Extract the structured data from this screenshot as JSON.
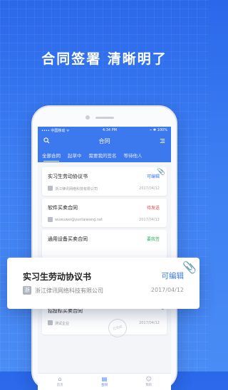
{
  "headline": "合同签署  清晰明了",
  "phone": {
    "status_bar": {
      "carrier": "•••• 中国移动 ᯤ",
      "time": "4:34 PM",
      "battery": "⌁ ✱ 100%"
    },
    "navbar": {
      "title": "合同"
    },
    "tabs": [
      "全部合同",
      "起草中",
      "需要我的签名",
      "等待他人"
    ],
    "cards": [
      {
        "title": "实习生劳动协议书",
        "status": "可编辑",
        "status_color": "#3c78ee",
        "company": "浙江律讯网络科技有限公司",
        "date": "2017/04/12",
        "clip": true
      },
      {
        "title": "软件买卖合同",
        "status": "待发送",
        "status_color": "#e8464d",
        "company": "wuwuwei@yuntaiwang.net",
        "date": "2017/04/12",
        "clip": false
      },
      {
        "title": "通用设备买卖合同",
        "status": "要我签",
        "status_color": "#2cab5a",
        "company": "",
        "date": "",
        "clip": false
      },
      {
        "title": "招投标买卖合同",
        "status": "",
        "status_color": "#999999",
        "company": "测试企业",
        "date": "2017/04/12",
        "clip": true,
        "stamp": "已完成"
      }
    ],
    "tabbar": [
      {
        "label": "首页",
        "icon": "home-icon",
        "active": false
      },
      {
        "label": "合同",
        "icon": "contract-icon",
        "active": true
      },
      {
        "label": "我的",
        "icon": "profile-icon",
        "active": false
      }
    ]
  },
  "float_card": {
    "title": "实习生劳动协议书",
    "status": "可编辑",
    "company_badge": "浙",
    "company": "浙江律讯网络科技有限公司",
    "date": "2017/04/12"
  }
}
